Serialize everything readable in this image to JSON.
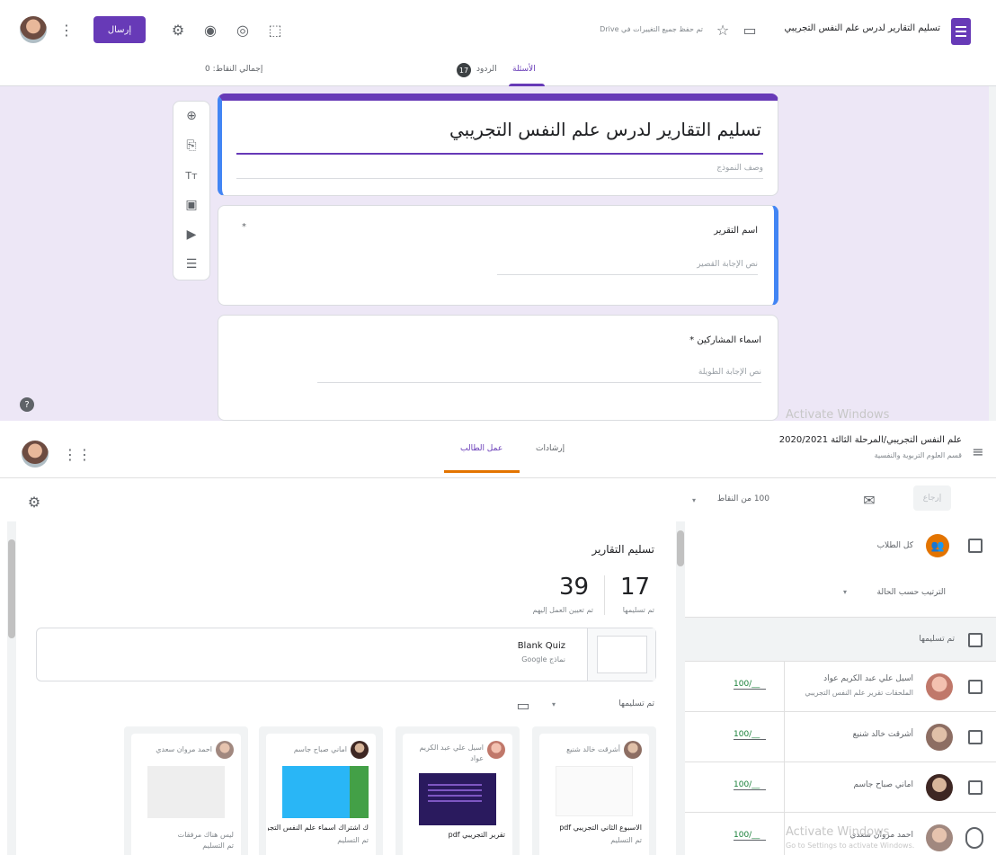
{
  "forms": {
    "title": "تسليم التقارير لدرس علم النفس التجريبي",
    "drive_status": "تم حفظ جميع التغييرات في Drive",
    "send_label": "إرسال",
    "tabs": [
      {
        "label": "الأسئلة",
        "active": true
      },
      {
        "label": "الردود",
        "badge": "17"
      },
      {
        "label": "إجمالي النقاط: 0"
      }
    ],
    "form_title": "تسليم التقارير لدرس علم النفس التجريبي",
    "form_description": "وصف النموذج",
    "questions": [
      {
        "label": "اسم التقرير",
        "required": "*",
        "placeholder": "نص الإجابة القصير"
      },
      {
        "label": "اسماء المشاركين",
        "required": "*",
        "placeholder": "نص الإجابة الطويلة"
      }
    ],
    "help_glyph": "?",
    "activate_windows": "Activate Windows"
  },
  "classroom": {
    "class_name": "علم النفس التجريبي/المرحلة الثالثة 2020/2021",
    "class_subtitle": "قسم العلوم التربوية والنفسية",
    "tabs": [
      {
        "label": "عمل الطالب",
        "active": true
      },
      {
        "label": "إرشادات"
      }
    ],
    "return_btn": "إرجاع",
    "points": "100 من النقاط",
    "all_students": "كل الطلاب",
    "sort_label": "الترتيب حسب الحالة",
    "section_submitted": "تم تسليمها",
    "students": [
      {
        "name": "اسيل علي عبد الكريم عواد",
        "note": "الملحقات تقرير علم النفس التجريبي",
        "grade": "100/__",
        "color": "#d7a9a0"
      },
      {
        "name": "أشرقت خالد شنيع",
        "grade": "100/__",
        "color": "#8d6e63"
      },
      {
        "name": "اماني صباح جاسم",
        "grade": "100/__",
        "color": "#4e342e"
      },
      {
        "name": "احمد مروان سعدي",
        "grade": "100/__",
        "color": "#a1887f"
      }
    ],
    "assignment_title": "تسليم التقارير",
    "stats": [
      {
        "value": "17",
        "label": "تم تسليمها"
      },
      {
        "value": "39",
        "label": "تم تعيين العمل إليهم"
      }
    ],
    "attachment": {
      "title": "Blank Quiz",
      "subtitle": "نماذج Google"
    },
    "filter_label": "تم تسليمها",
    "submissions": [
      {
        "name": "أشرقت خالد شنيع",
        "file": "الاسبوع الثاني التجريبي pdf",
        "status": "تم التسليم"
      },
      {
        "name": "اسيل علي عبد الكريم عواد",
        "file": "تقرير التجريبي pdf",
        "status": ""
      },
      {
        "name": "اماني صباح جاسم",
        "file": "ك اشتراك اسماء علم النفس التجريبي",
        "status": "تم التسليم"
      },
      {
        "name": "احمد مروان سعدي",
        "file": "ليس هناك مرفقات",
        "status": "تم التسليم"
      }
    ],
    "activate_windows": "Activate Windows",
    "activate_sub": "Go to Settings to activate Windows."
  }
}
